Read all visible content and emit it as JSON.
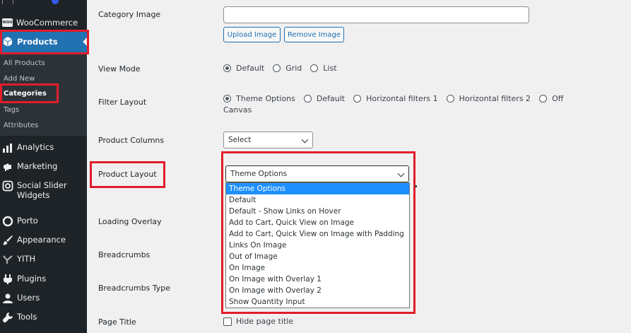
{
  "sidebar": {
    "woocommerce": "WooCommerce",
    "woo_badge": "WOO",
    "products": "Products",
    "submenu": [
      "All Products",
      "Add New",
      "Categories",
      "Tags",
      "Attributes"
    ],
    "analytics": "Analytics",
    "marketing": "Marketing",
    "social_slider": "Social Slider Widgets",
    "porto": "Porto",
    "appearance": "Appearance",
    "yith": "YITH",
    "plugins": "Plugins",
    "users": "Users",
    "tools": "Tools"
  },
  "form": {
    "category_image": {
      "label": "Category Image",
      "value": "",
      "upload": "Upload Image",
      "remove": "Remove Image"
    },
    "view_mode": {
      "label": "View Mode",
      "options": [
        "Default",
        "Grid",
        "List"
      ],
      "selected": "Default"
    },
    "filter_layout": {
      "label": "Filter Layout",
      "options": [
        "Theme Options",
        "Default",
        "Horizontal filters 1",
        "Horizontal filters 2",
        "Off"
      ],
      "wrap_text": "Canvas",
      "selected": "Theme Options"
    },
    "product_columns": {
      "label": "Product Columns",
      "value": "Select"
    },
    "product_layout": {
      "label": "Product Layout",
      "value": "Theme Options",
      "options": [
        "Theme Options",
        "Default",
        "Default - Show Links on Hover",
        "Add to Cart, Quick View on Image",
        "Add to Cart, Quick View on Image with Padding",
        "Links On Image",
        "Out of Image",
        "On Image",
        "On Image with Overlay 1",
        "On Image with Overlay 2",
        "Show Quantity Input"
      ],
      "highlighted": "Theme Options"
    },
    "loading_overlay": {
      "label": "Loading Overlay"
    },
    "breadcrumbs": {
      "label": "Breadcrumbs"
    },
    "breadcrumbs_type": {
      "label": "Breadcrumbs Type"
    },
    "page_title": {
      "label": "Page Title",
      "checkbox_label": "Hide page title"
    }
  },
  "colors": {
    "sidebar": "#1d2327",
    "accent": "#2271b1",
    "highlight": "#e11d2a",
    "dropdown_active": "#1e90ff"
  }
}
